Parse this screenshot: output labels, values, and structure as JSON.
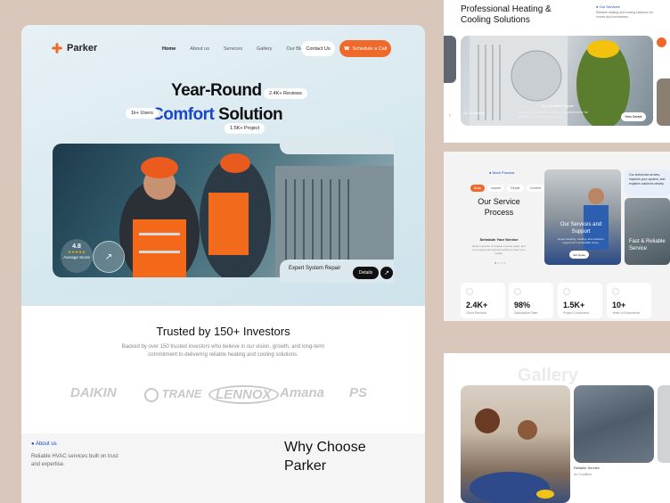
{
  "brand": {
    "name": "Parker"
  },
  "nav": {
    "items": [
      "Home",
      "About us",
      "Services",
      "Gallery",
      "Our Blog"
    ],
    "contact": "Contact Us",
    "schedule": "Schedule a Call"
  },
  "hero": {
    "line1": "Year-Round",
    "line2_blue": "Comfort",
    "line2_rest": " Solution",
    "chip_reviews": "2.4K+ Reviews",
    "chip_users": "1k+ Users",
    "chip_project": "1.5K+ Project",
    "rating_value": "4.8",
    "rating_stars": "★★★★★",
    "rating_label": "Average Score",
    "expert": "Expert System Repair",
    "details": "Details"
  },
  "trusted": {
    "title": "Trusted by 150+ Investors",
    "desc": "Backed by over 150 trusted investors who believe in our vision, growth, and long-term commitment to delivering reliable heating and cooling solutions."
  },
  "logos": [
    "DAIKIN",
    "TRANE",
    "LENNOX",
    "Amana",
    "PS"
  ],
  "why": {
    "about_label": "About us",
    "about_text": "Reliable HVAC services built on trust and expertise.",
    "title": "Why Choose Parker"
  },
  "right": {
    "title": "Professional Heating & Cooling Solutions",
    "services_label": "Our Services",
    "services_desc": "Reliable heating and cooling solutions for homes and businesses.",
    "card_ac": "AC Repairing",
    "card_ac2": "Air Condition Repair",
    "card_ac2_desc": "Expert AC installation, repair, and maintenance for efficient cooling all summer long.",
    "view_details": "View Details",
    "work_label": "Work Process",
    "tabs": [
      "Book",
      "Inspect",
      "Repair",
      "Comfort"
    ],
    "process_title": "Our Service Process",
    "process_step": "Schedule Your Service",
    "process_desc": "Book a service or request a quote today, and our experts will respond quickly to meet your needs.",
    "support_title": "Our Services and Support",
    "support_desc": "Expert Heating, Cooling, and customer support for Comfortable Living.",
    "get_quote": "Get Quote",
    "tech_desc": "Our technician arrives, inspects your system, and explains solutions clearly.",
    "fast_title": "Fast & Reliable Service",
    "stats": [
      {
        "value": "2.4K+",
        "label": "Client Reviews"
      },
      {
        "value": "98%",
        "label": "Satisfaction Rate"
      },
      {
        "value": "1.5K+",
        "label": "Project Completed"
      },
      {
        "value": "10+",
        "label": "Years of Experience"
      }
    ],
    "gallery": "Gallery",
    "reliable": "Reliable Service",
    "air_condition": "Air Condition"
  },
  "colors": {
    "accent": "#ef6a2a",
    "brand_blue": "#1a47c7"
  }
}
